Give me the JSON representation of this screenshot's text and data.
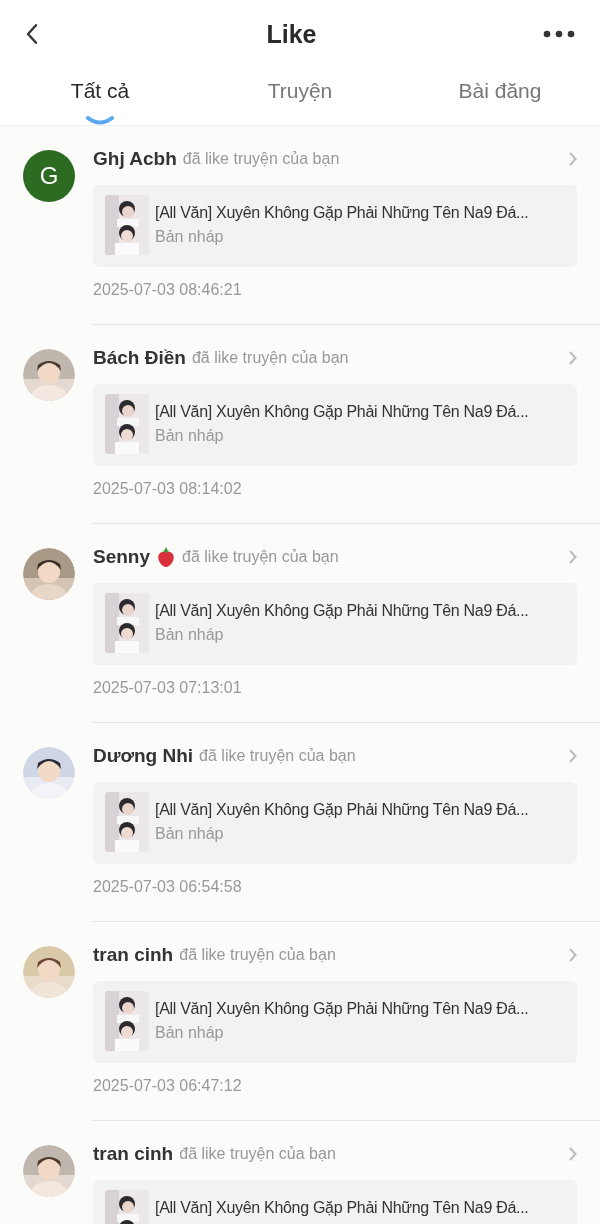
{
  "header": {
    "title": "Like"
  },
  "tabs": [
    {
      "label": "Tất cả",
      "selected": true
    },
    {
      "label": "Truyện",
      "selected": false
    },
    {
      "label": "Bài đăng",
      "selected": false
    }
  ],
  "notifications": [
    {
      "user": "Ghj Acbh",
      "avatar": {
        "kind": "letter",
        "letter": "G",
        "color": "#2e6b22"
      },
      "strawberry": false,
      "action": "đã like truyện của bạn",
      "story_title": "[All Văn] Xuyên Không Gặp Phải Những Tên Na9 Đá...",
      "story_status": "Bản nháp",
      "time": "2025-07-03 08:46:21"
    },
    {
      "user": "Bách Điền",
      "strawberry": false,
      "action": "đã like truyện của bạn",
      "story_title": "[All Văn] Xuyên Không Gặp Phải Những Tên Na9 Đá...",
      "story_status": "Bản nháp",
      "time": "2025-07-03 08:14:02"
    },
    {
      "user": "Senny",
      "strawberry": true,
      "action": "đã like truyện của bạn",
      "story_title": "[All Văn] Xuyên Không Gặp Phải Những Tên Na9 Đá...",
      "story_status": "Bản nháp",
      "time": "2025-07-03 07:13:01"
    },
    {
      "user": "Dương Nhi",
      "strawberry": false,
      "action": "đã like truyện của bạn",
      "story_title": "[All Văn] Xuyên Không Gặp Phải Những Tên Na9 Đá...",
      "story_status": "Bản nháp",
      "time": "2025-07-03 06:54:58"
    },
    {
      "user": "tran cinh",
      "strawberry": false,
      "action": "đã like truyện của bạn",
      "story_title": "[All Văn] Xuyên Không Gặp Phải Những Tên Na9 Đá...",
      "story_status": "Bản nháp",
      "time": "2025-07-03 06:47:12"
    },
    {
      "user": "tran cinh",
      "strawberry": false,
      "action": "đã like truyện của bạn",
      "story_title": "[All Văn] Xuyên Không Gặp Phải Những Tên Na9 Đá..."
    }
  ]
}
